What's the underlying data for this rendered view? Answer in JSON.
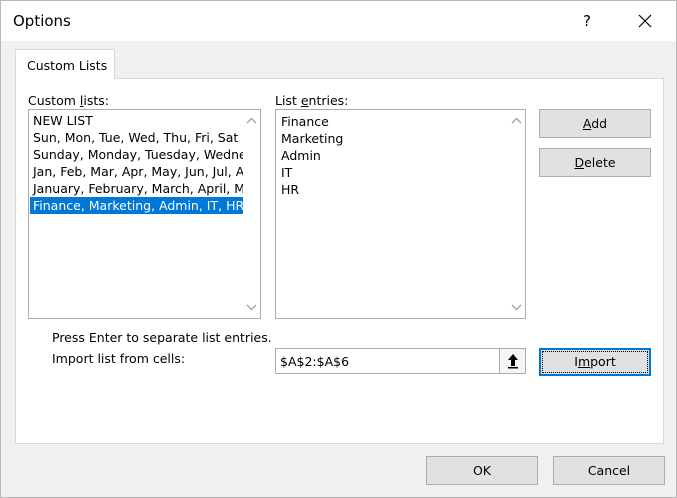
{
  "window": {
    "title": "Options",
    "help_label": "?",
    "close_icon": "close-icon"
  },
  "tabs": [
    {
      "label": "Custom Lists",
      "active": true
    }
  ],
  "custom_lists": {
    "label_prefix": "Custom ",
    "label_mnemonic": "l",
    "label_suffix": "ists:",
    "items": [
      "NEW LIST",
      "Sun, Mon, Tue, Wed, Thu, Fri, Sat",
      "Sunday, Monday, Tuesday, Wednesday, Thursday, Friday, Saturday",
      "Jan, Feb, Mar, Apr, May, Jun, Jul, Aug, Sep, Oct, Nov, Dec",
      "January, February, March, April, May, June, July, August, September, October, November, December",
      "Finance, Marketing, Admin, IT, HR"
    ],
    "selected_index": 5
  },
  "list_entries": {
    "label_prefix": "List ",
    "label_mnemonic": "e",
    "label_suffix": "ntries:",
    "items": [
      "Finance",
      "Marketing",
      "Admin",
      "IT",
      "HR"
    ]
  },
  "buttons": {
    "add_mnemonic": "A",
    "add_rest": "dd",
    "delete_mnemonic": "D",
    "delete_rest": "elete",
    "import_prefix": "I",
    "import_mnemonic": "m",
    "import_rest": "port",
    "ok": "OK",
    "cancel": "Cancel"
  },
  "hint_text": "Press Enter to separate list entries.",
  "import_label": "Import list from cells:",
  "import_range": "$A$2:$A$6",
  "colors": {
    "selection": "#0078d7",
    "dialog_bg": "#f0f0f0",
    "button_bg": "#e1e1e1"
  }
}
